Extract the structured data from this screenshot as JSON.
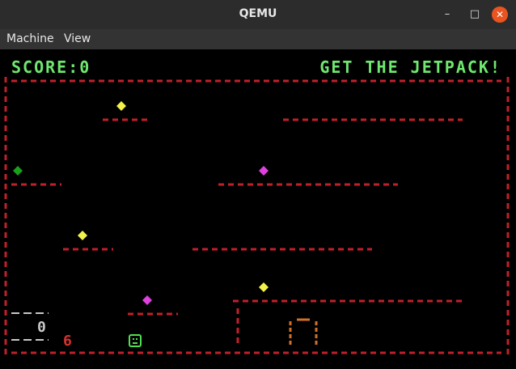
{
  "window": {
    "title": "QEMU"
  },
  "menu": {
    "items": [
      "Machine",
      "View"
    ]
  },
  "hud": {
    "score": "SCORE:0",
    "message": "GET THE JETPACK!"
  },
  "status": {
    "fuel": "0",
    "lives": "6"
  },
  "colors": {
    "wall": "#c0202a",
    "hud": "#6ee86e",
    "gem_yellow": "#f2f04a",
    "gem_magenta": "#e040e0",
    "gem_green": "#1aa01a",
    "door": "#d0702a",
    "player": "#4fe04f"
  },
  "icons": [
    "minimize-icon",
    "maximize-icon",
    "close-icon"
  ]
}
